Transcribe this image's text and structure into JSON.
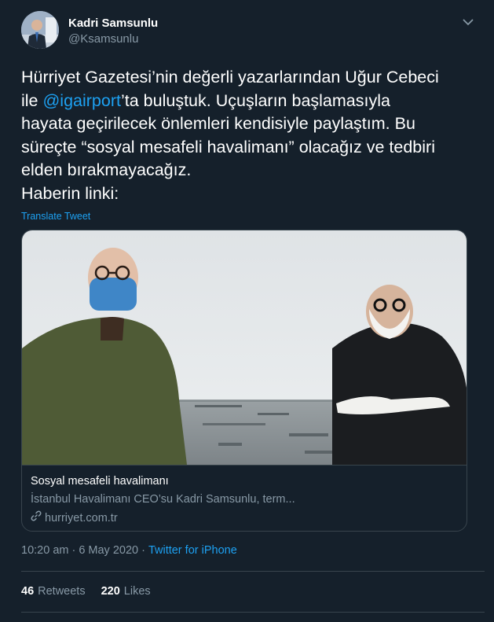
{
  "author": {
    "name": "Kadri Samsunlu",
    "handle": "@Ksamsunlu"
  },
  "tweet": {
    "line1": "Hürriyet Gazetesi’nin değerli yazarlarından Uğur Cebeci",
    "line2_prefix": "ile ",
    "line2_mention": "@igairport",
    "line2_suffix": "’ta buluştuk. Uçuşların başlamasıyla",
    "line3": "hayata geçirilecek önlemleri kendisiyle paylaştım. Bu",
    "line4": "süreçte “sosyal mesafeli havalimanı” olacağız ve tedbiri",
    "line5": "elden bırakmayacağız.",
    "line6": "Haberin linki:",
    "translate_label": "Translate Tweet"
  },
  "card": {
    "title": "Sosyal mesafeli havalimanı",
    "description": "İstanbul Havalimanı CEO’su Kadri Samsunlu, term...",
    "domain": "hurriyet.com.tr",
    "link_icon": "link-icon"
  },
  "meta": {
    "time": "10:20 am",
    "separator": "·",
    "date": "6 May 2020",
    "source": "Twitter for iPhone"
  },
  "stats": {
    "retweets_count": "46",
    "retweets_label": "Retweets",
    "likes_count": "220",
    "likes_label": "Likes"
  },
  "colors": {
    "background": "#15202b",
    "accent": "#1da1f2",
    "secondary_text": "#8899a6",
    "border": "#38444d"
  }
}
